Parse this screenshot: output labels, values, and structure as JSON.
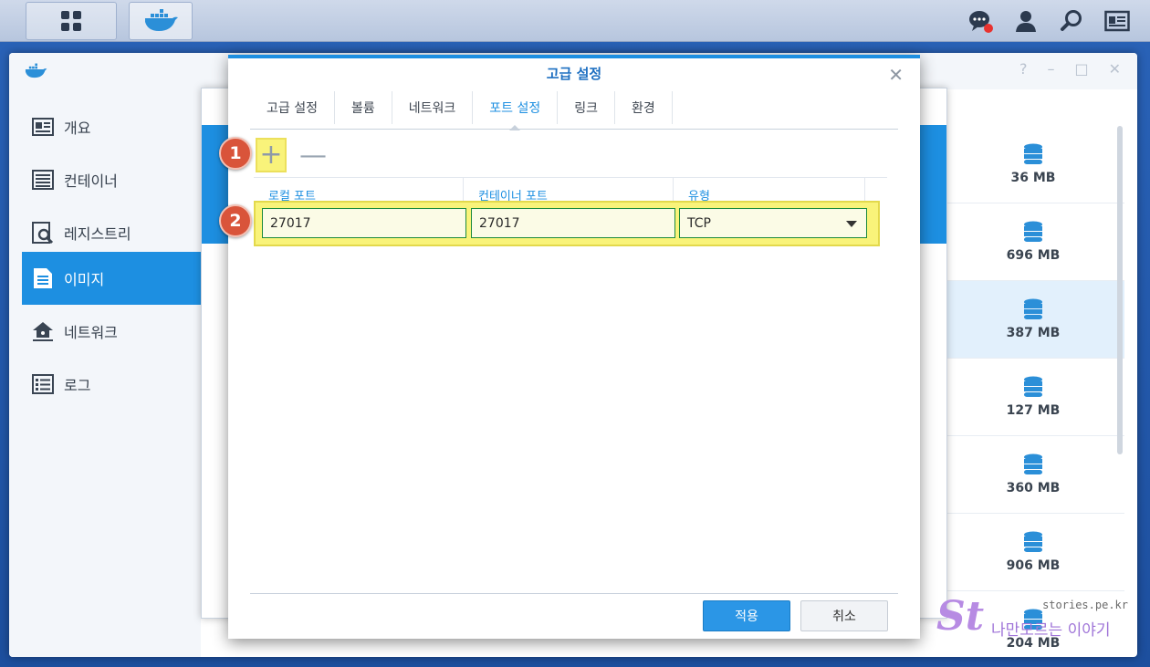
{
  "taskbar": {
    "main_menu_icon": "grid-icon",
    "docker_icon": "docker-whale-icon",
    "right_icons": [
      "chat-notification-icon",
      "user-icon",
      "search-icon",
      "widget-card-icon"
    ]
  },
  "main_window": {
    "title_icon": "docker-whale-icon",
    "controls": [
      "?",
      "–",
      "□",
      "✕"
    ]
  },
  "sidebar": {
    "items": [
      {
        "label": "개요",
        "icon": "overview-card-icon"
      },
      {
        "label": "컨테이너",
        "icon": "container-list-icon"
      },
      {
        "label": "레지스트리",
        "icon": "registry-search-icon"
      },
      {
        "label": "이미지",
        "icon": "image-doc-icon"
      },
      {
        "label": "네트워크",
        "icon": "network-house-icon"
      },
      {
        "label": "로그",
        "icon": "log-list-icon"
      }
    ],
    "active_index": 3
  },
  "image_sizes": [
    "36 MB",
    "696 MB",
    "387 MB",
    "127 MB",
    "360 MB",
    "906 MB",
    "204 MB"
  ],
  "dialog": {
    "title": "고급 설정",
    "tabs": [
      "고급 설정",
      "볼륨",
      "네트워크",
      "포트 설정",
      "링크",
      "환경"
    ],
    "active_tab": "포트 설정",
    "add_symbol": "+",
    "remove_symbol": "—",
    "columns": {
      "local_port": "로컬 포트",
      "container_port": "컨테이너 포트",
      "type": "유형"
    },
    "row": {
      "local_port": "27017",
      "container_port": "27017",
      "type": "TCP"
    },
    "badges": [
      "1",
      "2"
    ],
    "apply_label": "적용",
    "cancel_label": "취소"
  },
  "watermark": {
    "logo": "St",
    "url": "stories.pe.kr",
    "text": "나만모르는 이야기"
  },
  "colors": {
    "accent": "#1d8fe1",
    "highlight": "#f9f37a",
    "badge": "#d9543a"
  }
}
